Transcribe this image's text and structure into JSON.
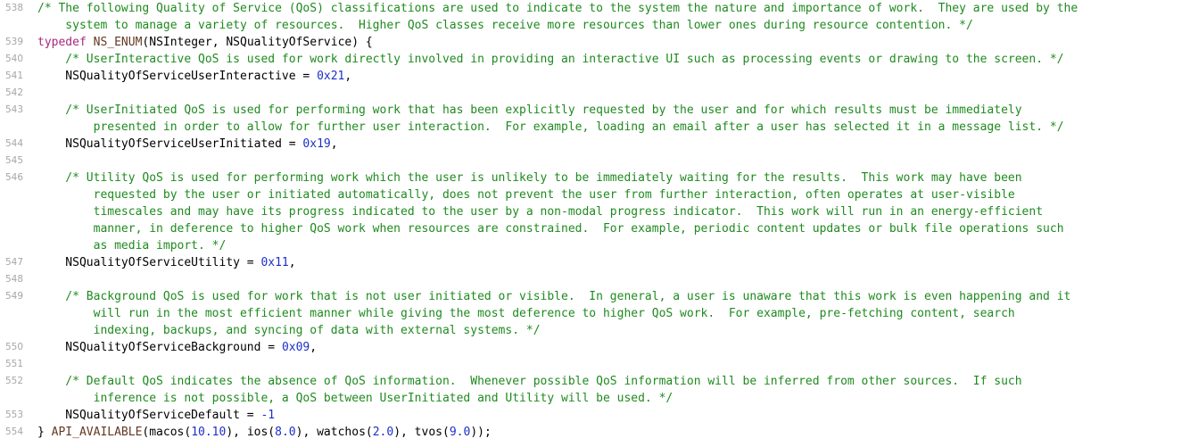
{
  "colors": {
    "comment": "#1f8a1f",
    "keyword": "#a8287f",
    "number": "#1c2fc9",
    "macro": "#643820",
    "line_number": "#a6a6a6",
    "plain": "#000000",
    "background": "#ffffff"
  },
  "lines": {
    "538": {
      "num": "538",
      "text": "/* The following Quality of Service (QoS) classifications are used to indicate to the system the nature and importance of work.  They are used by the"
    },
    "538b": {
      "text": "    system to manage a variety of resources.  Higher QoS classes receive more resources than lower ones during resource contention. */"
    },
    "539": {
      "num": "539",
      "kw": "typedef",
      "macro": "NS_ENUM",
      "rest": "(NSInteger, NSQualityOfService) {"
    },
    "540": {
      "num": "540",
      "text": "    /* UserInteractive QoS is used for work directly involved in providing an interactive UI such as processing events or drawing to the screen. */"
    },
    "541": {
      "num": "541",
      "name": "    NSQualityOfServiceUserInteractive = ",
      "value": "0x21",
      "tail": ","
    },
    "542": {
      "num": "542"
    },
    "543": {
      "num": "543",
      "text": "    /* UserInitiated QoS is used for performing work that has been explicitly requested by the user and for which results must be immediately"
    },
    "543b": {
      "text": "        presented in order to allow for further user interaction.  For example, loading an email after a user has selected it in a message list. */"
    },
    "544": {
      "num": "544",
      "name": "    NSQualityOfServiceUserInitiated = ",
      "value": "0x19",
      "tail": ","
    },
    "545": {
      "num": "545"
    },
    "546": {
      "num": "546",
      "text": "    /* Utility QoS is used for performing work which the user is unlikely to be immediately waiting for the results.  This work may have been"
    },
    "546b": {
      "text": "        requested by the user or initiated automatically, does not prevent the user from further interaction, often operates at user-visible"
    },
    "546c": {
      "text": "        timescales and may have its progress indicated to the user by a non-modal progress indicator.  This work will run in an energy-efficient"
    },
    "546d": {
      "text": "        manner, in deference to higher QoS work when resources are constrained.  For example, periodic content updates or bulk file operations such"
    },
    "546e": {
      "text": "        as media import. */"
    },
    "547": {
      "num": "547",
      "name": "    NSQualityOfServiceUtility = ",
      "value": "0x11",
      "tail": ","
    },
    "548": {
      "num": "548"
    },
    "549": {
      "num": "549",
      "text": "    /* Background QoS is used for work that is not user initiated or visible.  In general, a user is unaware that this work is even happening and it"
    },
    "549b": {
      "text": "        will run in the most efficient manner while giving the most deference to higher QoS work.  For example, pre-fetching content, search"
    },
    "549c": {
      "text": "        indexing, backups, and syncing of data with external systems. */"
    },
    "550": {
      "num": "550",
      "name": "    NSQualityOfServiceBackground = ",
      "value": "0x09",
      "tail": ","
    },
    "551": {
      "num": "551"
    },
    "552": {
      "num": "552",
      "text": "    /* Default QoS indicates the absence of QoS information.  Whenever possible QoS information will be inferred from other sources.  If such"
    },
    "552b": {
      "text": "        inference is not possible, a QoS between UserInitiated and Utility will be used. */"
    },
    "553": {
      "num": "553",
      "name": "    NSQualityOfServiceDefault = ",
      "value": "-1"
    },
    "554": {
      "num": "554",
      "open": "} ",
      "macro": "API_AVAILABLE",
      "p1": "(macos(",
      "v1": "10.10",
      "p2": "), ios(",
      "v2": "8.0",
      "p3": "), watchos(",
      "v3": "2.0",
      "p4": "), tvos(",
      "v4": "9.0",
      "p5": "));"
    }
  }
}
